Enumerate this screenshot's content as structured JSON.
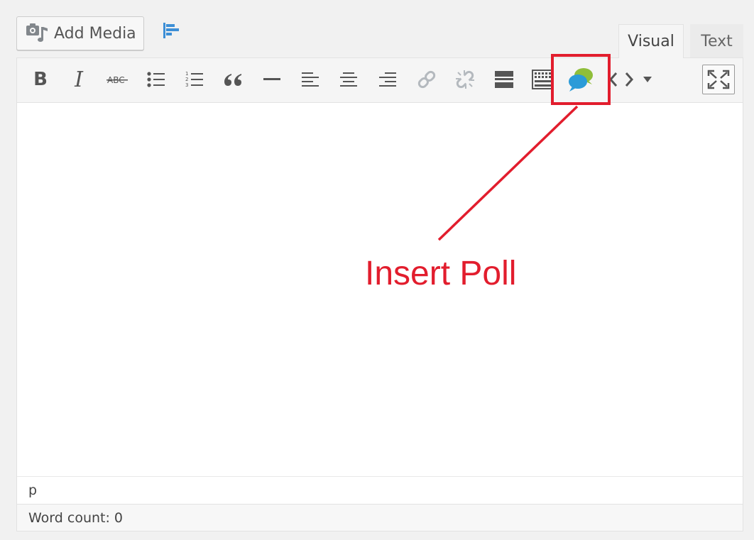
{
  "media": {
    "add_media_label": "Add Media"
  },
  "tabs": [
    {
      "label": "Visual",
      "active": true
    },
    {
      "label": "Text",
      "active": false
    }
  ],
  "toolbar": {
    "bold_label": "B",
    "italic_label": "I",
    "buttons": [
      "bold",
      "italic",
      "strikethrough",
      "bulleted-list",
      "numbered-list",
      "blockquote",
      "horizontal-line",
      "align-left",
      "align-center",
      "align-right",
      "insert-link",
      "remove-link",
      "read-more",
      "toolbar-toggle",
      "insert-poll",
      "code",
      "dropdown"
    ]
  },
  "editor": {
    "path": "p",
    "word_count_label": "Word count: 0"
  },
  "annotation": {
    "label": "Insert Poll",
    "color": "#e21d2d"
  },
  "colors": {
    "background": "#f1f1f1",
    "toolbar": "#f5f5f5",
    "icon": "#555555",
    "icon_disabled": "#b4b9be",
    "poll_green": "#8fbe3a",
    "poll_blue": "#2b9bd8",
    "chart_blue": "#3d8fd6"
  }
}
